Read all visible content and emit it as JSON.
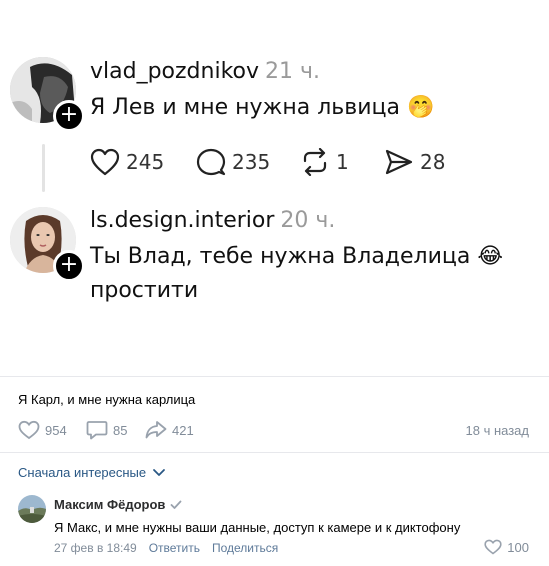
{
  "thread": {
    "post1": {
      "username": "vlad_pozdnikov",
      "time": "21 ч.",
      "text": "Я Лев и мне нужна львица 🤭",
      "avatar_icon": "profile-photo-dark-icon",
      "likes": "245",
      "replies": "235",
      "reposts": "1",
      "shares": "28"
    },
    "post2": {
      "username": "ls.design.interior",
      "time": "20 ч.",
      "text_line1": "Ты Влад, тебе нужна Владелица 😂",
      "text_line2": "простити",
      "avatar_icon": "profile-photo-woman-icon"
    },
    "colors": {
      "text": "#111111",
      "muted": "#9a9a9a",
      "line": "#e3e3e3"
    }
  },
  "vk": {
    "post": {
      "text": "Я Карл, и мне нужна карлица",
      "likes": "954",
      "comments": "85",
      "shares": "421",
      "time": "18 ч назад"
    },
    "sort_label": "Сначала интересные",
    "comment": {
      "author": "Максим Фёдоров",
      "text": "Я Макс, и мне нужны ваши данные, доступ к камере и к диктофону",
      "date": "27 фев в 18:49",
      "reply_label": "Ответить",
      "share_label": "Поделиться",
      "likes": "100",
      "avatar_icon": "landscape-avatar-icon"
    },
    "colors": {
      "link": "#2a5885",
      "meta": "#818c99",
      "border": "#e7e8ec"
    }
  }
}
